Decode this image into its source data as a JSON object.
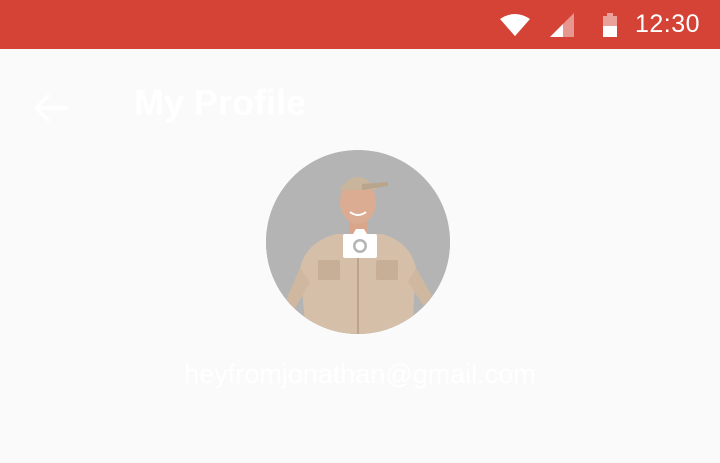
{
  "status_bar": {
    "time": "12:30",
    "icons": [
      "wifi-icon",
      "signal-icon",
      "battery-icon"
    ],
    "color": "#d44335"
  },
  "header": {
    "back_icon": "back-arrow-icon",
    "title": "My Profile"
  },
  "profile": {
    "avatar_overlay_icon": "camera-icon",
    "email": "heyfromjonathan@gmail.com"
  },
  "colors": {
    "background": "#fafafa",
    "accent": "#d44335",
    "text_on_bg": "#ffffff"
  }
}
